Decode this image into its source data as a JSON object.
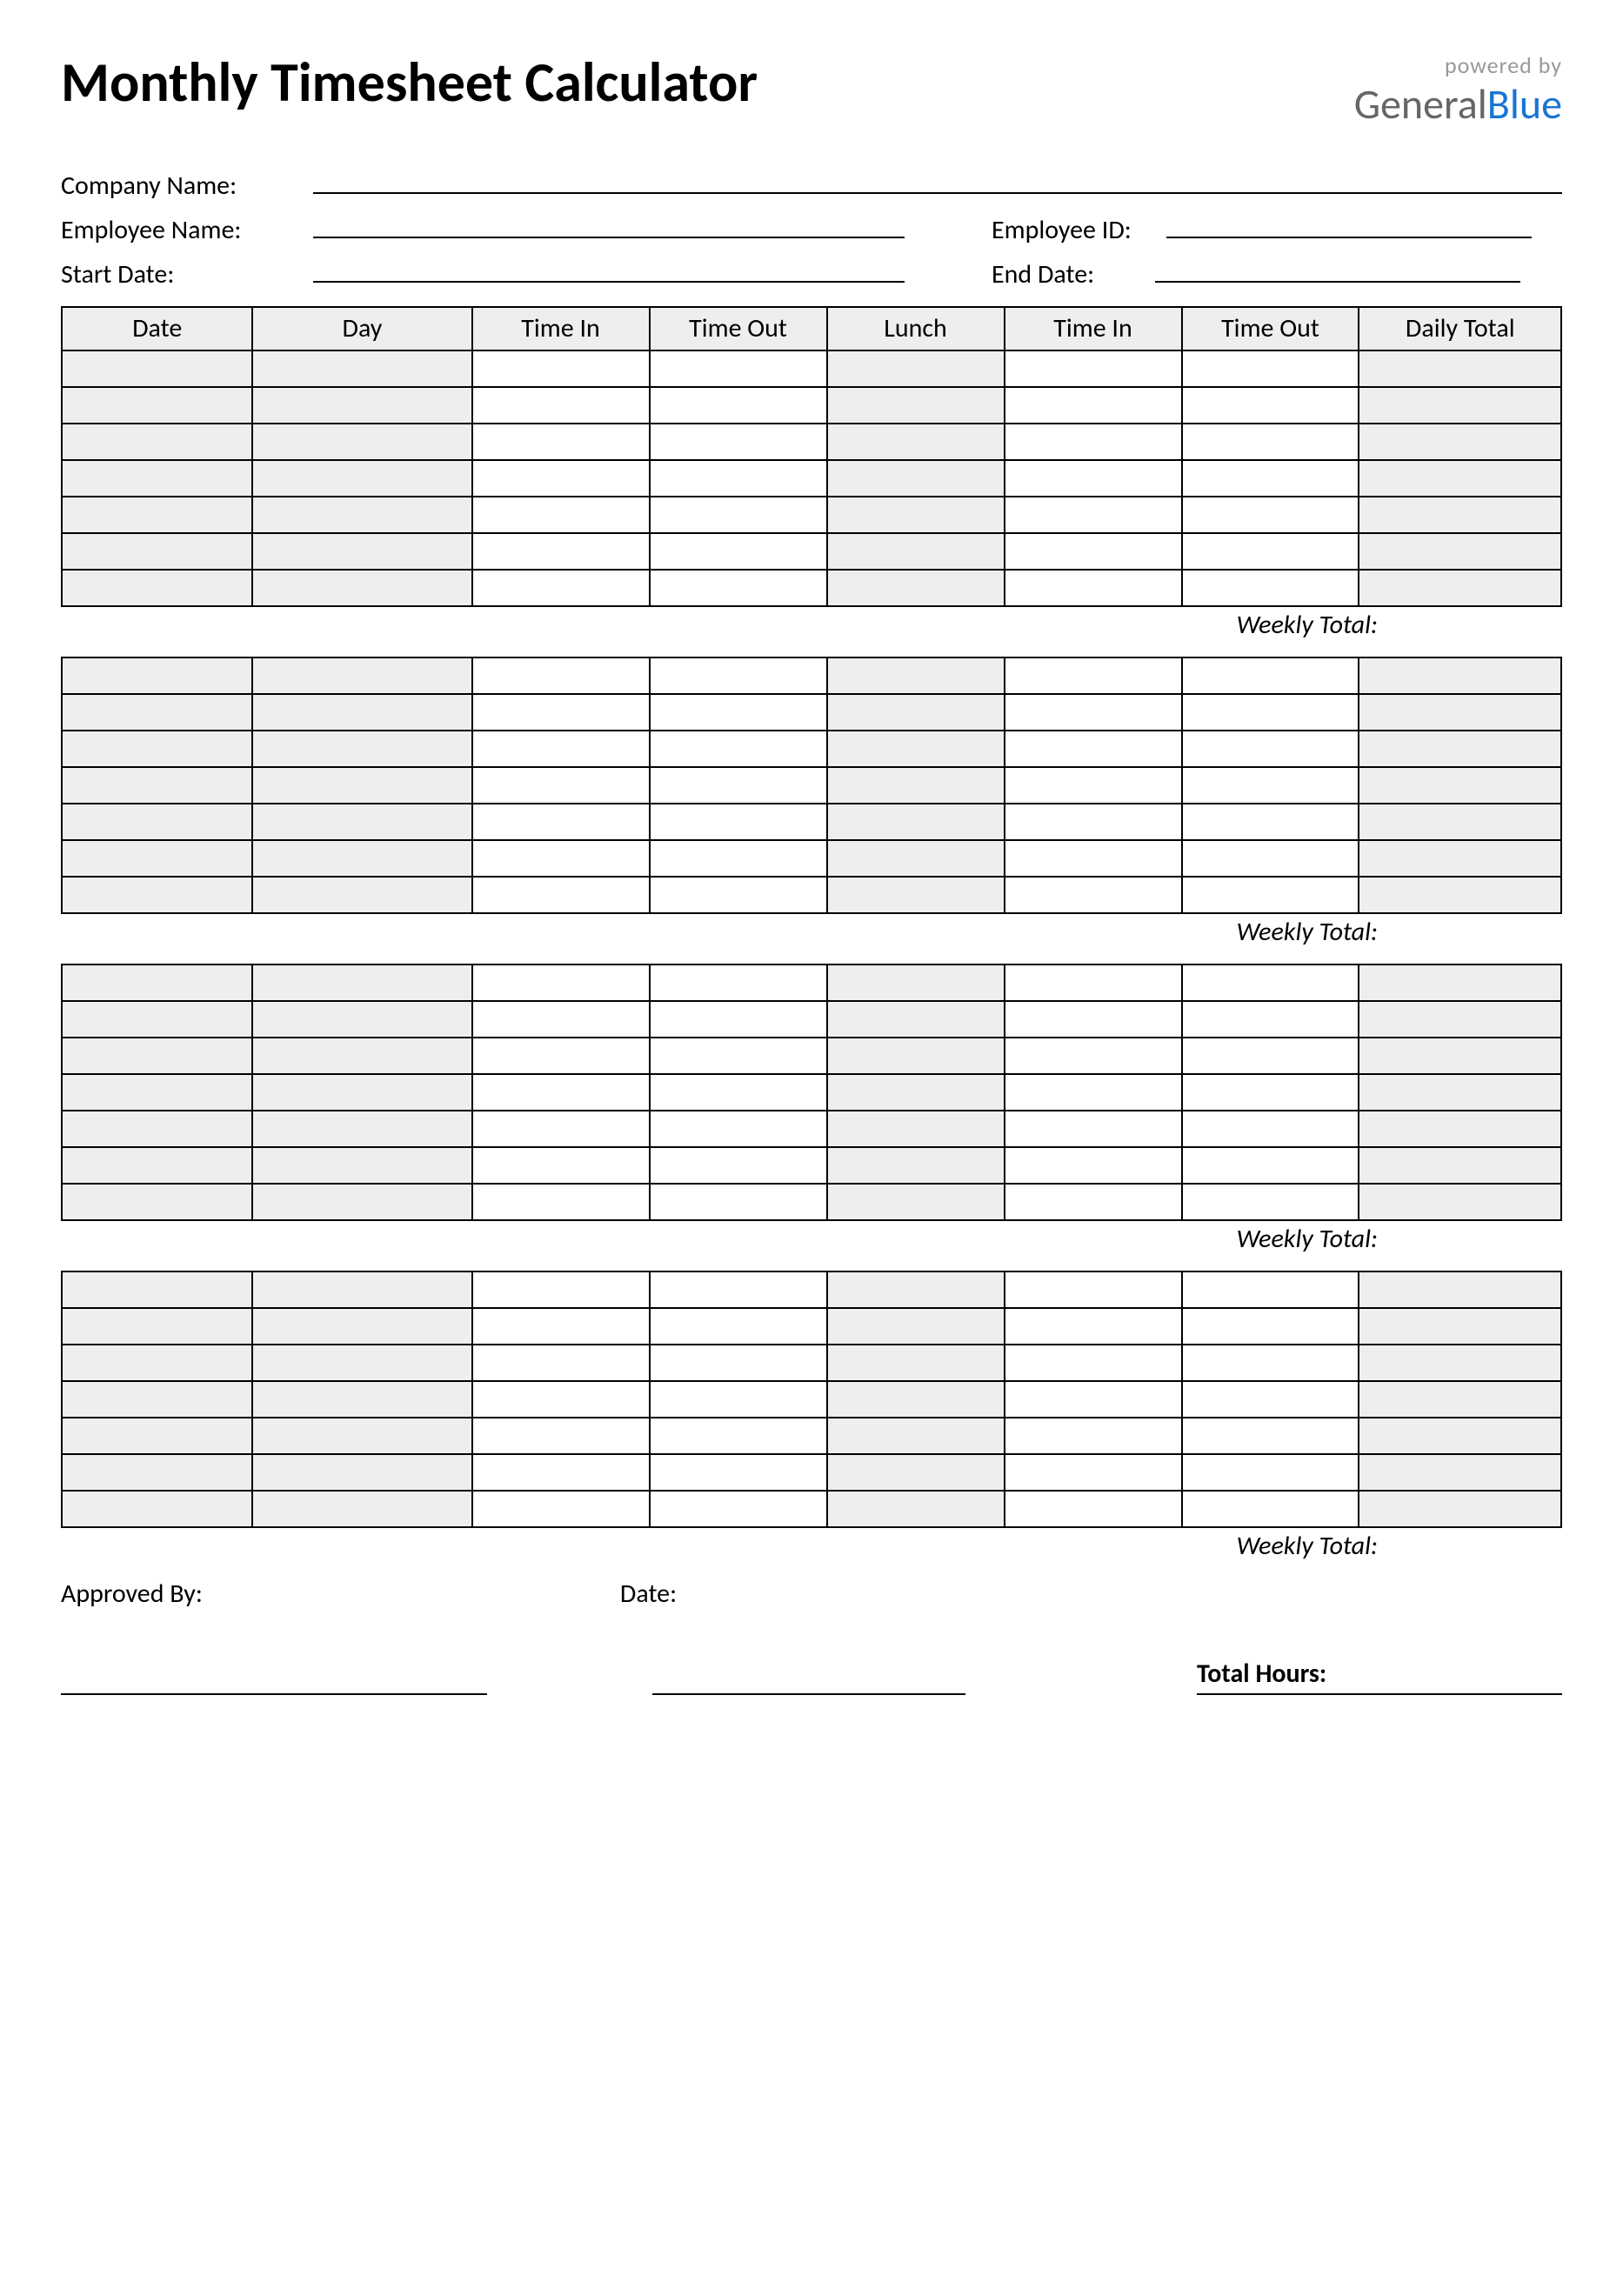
{
  "title": "Monthly Timesheet Calculator",
  "logo": {
    "powered": "powered by",
    "brand1": "General",
    "brand2": "Blue"
  },
  "info": {
    "company_label": "Company Name:",
    "employee_label": "Employee Name:",
    "empid_label": "Employee ID:",
    "start_label": "Start Date:",
    "end_label": "End Date:"
  },
  "columns": [
    "Date",
    "Day",
    "Time In",
    "Time Out",
    "Lunch",
    "Time In",
    "Time Out",
    "Daily Total"
  ],
  "weekly_total_label": "Weekly Total:",
  "approved_label": "Approved By:",
  "date_label": "Date:",
  "total_hours_label": "Total Hours:"
}
